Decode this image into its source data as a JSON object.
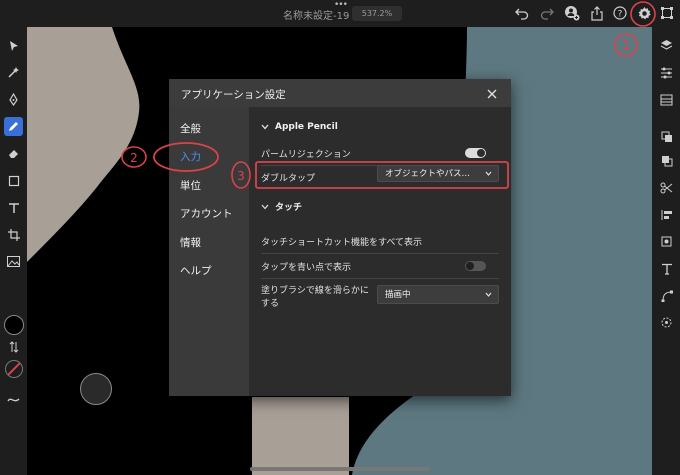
{
  "toolbar": {
    "doc_title": "名称未設定-19",
    "zoom": "537.2%",
    "icons": [
      "undo-icon",
      "redo-icon",
      "person-add-icon",
      "share-icon",
      "help-icon",
      "settings-icon",
      "fullscreen-icon"
    ]
  },
  "colors": {
    "accent": "#3a6fd8",
    "nav_active": "#4d8ef0",
    "annotation": "#d9434b",
    "canvas_teal": "#5d7880",
    "canvas_beige": "#a89f96"
  },
  "dialog": {
    "title": "アプリケーション設定",
    "nav": [
      "全般",
      "入力",
      "単位",
      "アカウント",
      "情報",
      "ヘルプ"
    ],
    "active_nav": "入力",
    "apple_pencil": {
      "header": "Apple Pencil",
      "palm_rejection_label": "パームリジェクション",
      "palm_rejection_on": true,
      "double_tap_label": "ダブルタップ",
      "double_tap_value": "オブジェクトやパス…"
    },
    "touch": {
      "header": "タッチ",
      "show_shortcuts_label": "タッチショートカット機能をすべて表示",
      "blue_dot_label": "タップを青い点で表示",
      "blue_dot_on": false,
      "smooth_label_line1": "塗りブラシで線を滑らかに",
      "smooth_label_line2": "する",
      "smooth_value": "描画中"
    }
  },
  "annotations": [
    "1",
    "2",
    "3"
  ]
}
